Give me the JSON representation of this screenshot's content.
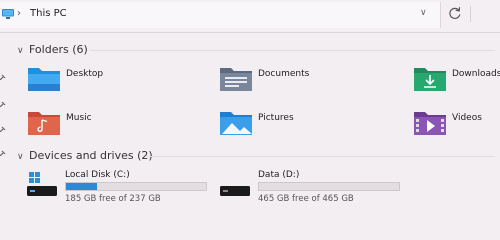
{
  "address_bar": {
    "location": "This PC",
    "icons": {
      "location": "pc-icon",
      "separator": "chevron-right-icon",
      "dropdown": "chevron-down-icon",
      "refresh": "refresh-icon"
    }
  },
  "sections": {
    "folders": {
      "title": "Folders (6)"
    },
    "drives": {
      "title": "Devices and drives (2)"
    }
  },
  "folders": [
    {
      "label": "Desktop",
      "icon": "desktop-folder-icon"
    },
    {
      "label": "Documents",
      "icon": "documents-folder-icon"
    },
    {
      "label": "Downloads",
      "icon": "downloads-folder-icon"
    },
    {
      "label": "Music",
      "icon": "music-folder-icon"
    },
    {
      "label": "Pictures",
      "icon": "pictures-folder-icon"
    },
    {
      "label": "Videos",
      "icon": "videos-folder-icon"
    }
  ],
  "drives": [
    {
      "name": "Local Disk (C:)",
      "free_text": "185 GB free of 237 GB",
      "used_fraction": 0.22,
      "icon": "windows-drive-icon"
    },
    {
      "name": "Data (D:)",
      "free_text": "465 GB free of 465 GB",
      "used_fraction": 0.0,
      "icon": "hard-drive-icon"
    }
  ],
  "colors": {
    "usage_bar": "#2c88d8",
    "usage_track": "#e4dee3"
  }
}
